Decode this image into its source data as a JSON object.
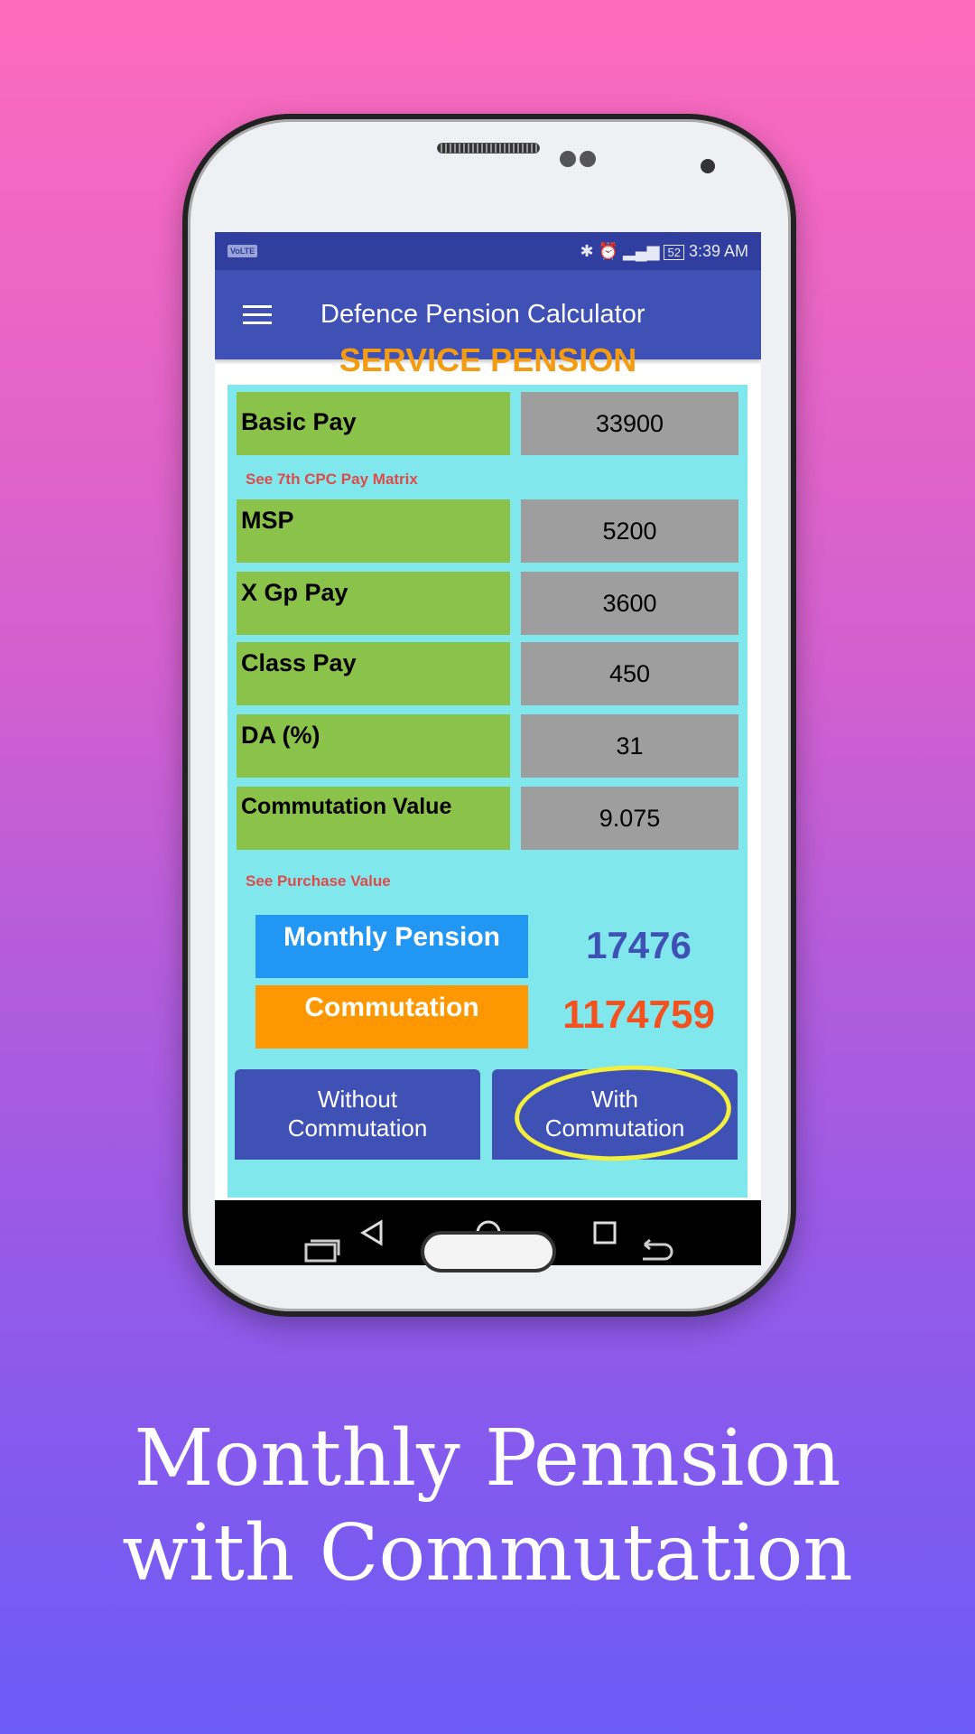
{
  "status_bar": {
    "volte": "VoLTE",
    "battery": "52",
    "time": "3:39 AM"
  },
  "app_bar": {
    "title": "Defence Pension Calculator",
    "menu_icon": "hamburger-icon"
  },
  "heading": "SERVICE PENSION",
  "fields": [
    {
      "label": "Basic Pay",
      "value": "33900"
    },
    {
      "label": "MSP",
      "value": "5200"
    },
    {
      "label": "X Gp Pay",
      "value": "3600"
    },
    {
      "label": "Class Pay",
      "value": "450"
    },
    {
      "label": "DA (%)",
      "value": "31"
    },
    {
      "label": "Commutation Value",
      "value": "9.075"
    }
  ],
  "links": {
    "pay_matrix": "See 7th CPC Pay Matrix",
    "purchase_value": "See Purchase Value"
  },
  "results": {
    "monthly_label": "Monthly Pension",
    "monthly_value": "17476",
    "commutation_label": "Commutation",
    "commutation_value": "1174759"
  },
  "buttons": {
    "without_line1": "Without",
    "without_line2": "Commutation",
    "with_line1": "With",
    "with_line2": "Commutation"
  },
  "caption": {
    "line1": "Monthly Pennsion",
    "line2": "with Commutation"
  },
  "colors": {
    "appbar": "#3f51b5",
    "label_bg": "#8bc34a",
    "value_bg": "#9e9e9e",
    "panel": "#80e8ec",
    "heading": "#f39c12",
    "monthly_box": "#2196f3",
    "commutation_box": "#ff9800",
    "monthly_value": "#3f51b5",
    "commutation_value": "#f4511e",
    "highlight": "#f3ef3a"
  }
}
